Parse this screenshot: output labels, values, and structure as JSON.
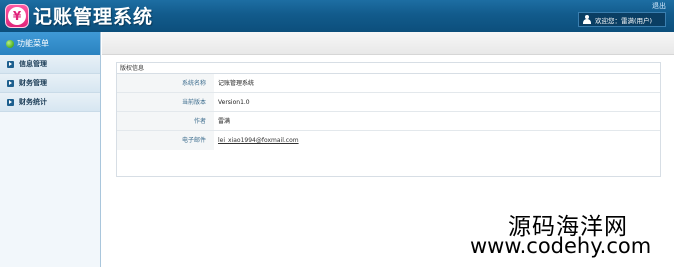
{
  "header": {
    "logo_char": "¥",
    "title": "记账管理系统",
    "logout_label": "退出",
    "welcome_text": "欢迎您：雷满(用户)"
  },
  "sidebar": {
    "header_label": "功能菜单",
    "items": [
      {
        "label": "信息管理"
      },
      {
        "label": "财务管理"
      },
      {
        "label": "财务统计"
      }
    ]
  },
  "panel": {
    "title": "版权信息",
    "rows": [
      {
        "label": "系统名称",
        "value": "记账管理系统"
      },
      {
        "label": "当前版本",
        "value": "Version1.0"
      },
      {
        "label": "作者",
        "value": "雷满"
      },
      {
        "label": "电子邮件",
        "value": "lei_xiao1994@foxmail.com"
      }
    ]
  },
  "watermark": {
    "cn": "源码海洋网",
    "url": "www.codehy.com"
  },
  "colors": {
    "header_bg": "#125b8c",
    "sidebar_header_bg": "#2a82c0",
    "logo_pink": "#e0247a"
  }
}
